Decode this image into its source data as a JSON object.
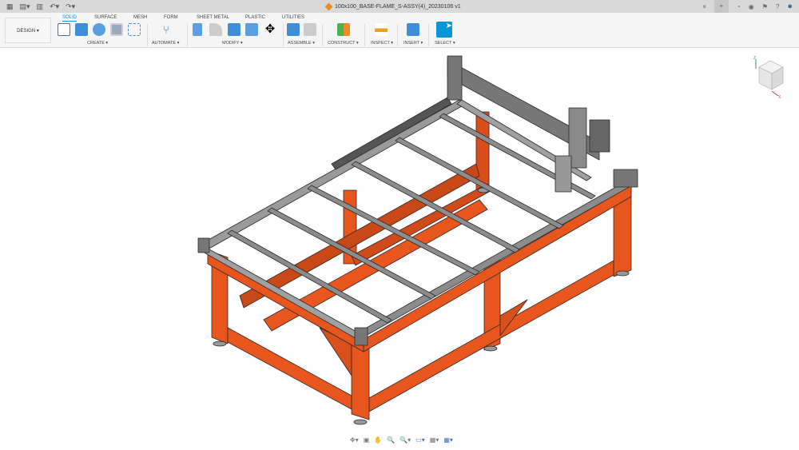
{
  "quick_access": {
    "grid": "▦",
    "file": "▤▾",
    "save": "▥",
    "undo": "↶▾",
    "redo": "↷▾"
  },
  "document": {
    "title": "100x100_BASE-FLAME_S-ASSY(4)_20230106 v1",
    "close": "×"
  },
  "header_icons": {
    "new_tab": "+",
    "job_status": "◔",
    "extensions": "◉",
    "notifications": "⚑",
    "help": "?",
    "profile": "●"
  },
  "workspace": {
    "label": "DESIGN ▾"
  },
  "tabs": [
    {
      "label": "SOLID",
      "active": true
    },
    {
      "label": "SURFACE"
    },
    {
      "label": "MESH"
    },
    {
      "label": "FORM"
    },
    {
      "label": "SHEET METAL"
    },
    {
      "label": "PLASTIC"
    },
    {
      "label": "UTILITIES"
    }
  ],
  "groups": {
    "create": "CREATE ▾",
    "automate": "AUTOMATE ▾",
    "modify": "MODIFY ▾",
    "assemble": "ASSEMBLE ▾",
    "construct": "CONSTRUCT ▾",
    "inspect": "INSPECT ▾",
    "insert": "INSERT ▾",
    "select": "SELECT ▾"
  },
  "colors": {
    "accent": "#0696d7",
    "frame": "#e8561e",
    "rail": "#8c8c8c"
  },
  "viewcube": {
    "z": "Z",
    "x": "X",
    "y": "Y"
  },
  "navbar": {
    "orbit": "✥▾",
    "look": "▣",
    "pan": "✋",
    "zoom": "🔍",
    "fit": "🔍▾",
    "display": "▭▾",
    "grid": "▦▾",
    "viewports": "▦▾"
  }
}
